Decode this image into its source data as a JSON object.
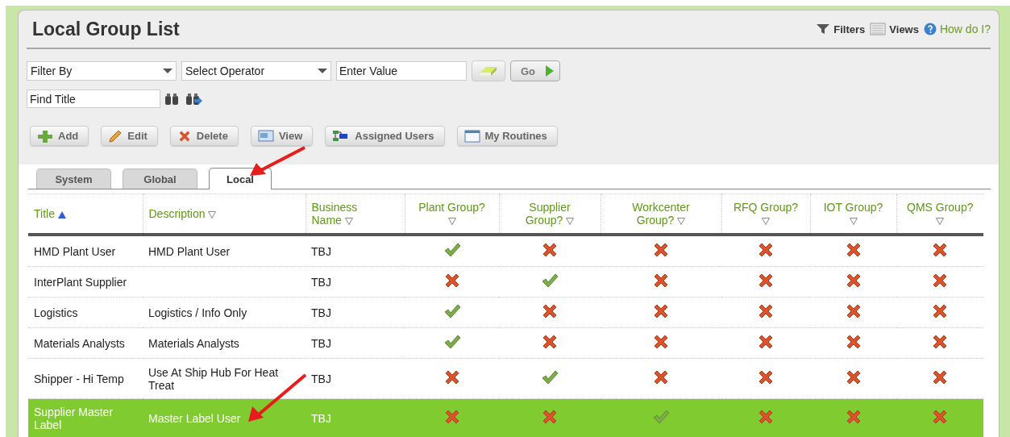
{
  "window": {
    "title": "Local Group List"
  },
  "header_links": [
    {
      "kind": "filters",
      "label": "Filters"
    },
    {
      "kind": "views",
      "label": "Views"
    },
    {
      "kind": "help",
      "label": "How do I?"
    }
  ],
  "filter": {
    "filter_by": "Filter By",
    "operator": "Select Operator",
    "value_placeholder": "Enter Value",
    "go_label": "Go",
    "find_placeholder": "Find Title"
  },
  "buttons": [
    {
      "kind": "add",
      "label": "Add"
    },
    {
      "kind": "edit",
      "label": "Edit"
    },
    {
      "kind": "delete",
      "label": "Delete"
    },
    {
      "kind": "view",
      "label": "View"
    },
    {
      "kind": "users",
      "label": "Assigned Users"
    },
    {
      "kind": "routines",
      "label": "My Routines"
    }
  ],
  "tabs": [
    {
      "label": "System",
      "selected": false
    },
    {
      "label": "Global",
      "selected": false
    },
    {
      "label": "Local",
      "selected": true
    }
  ],
  "table": {
    "columns": [
      {
        "label": "Title",
        "sorted": true
      },
      {
        "label": "Description",
        "sorted": false
      },
      {
        "label": "Business Name",
        "sorted": false
      },
      {
        "label": "Plant Group?",
        "sorted": false
      },
      {
        "label": "Supplier Group?",
        "sorted": false
      },
      {
        "label": "Workcenter Group?",
        "sorted": false
      },
      {
        "label": "RFQ Group?",
        "sorted": false
      },
      {
        "label": "IOT Group?",
        "sorted": false
      },
      {
        "label": "QMS Group?",
        "sorted": false
      }
    ],
    "rows": [
      {
        "title": "HMD Plant User",
        "description": "HMD Plant User",
        "business": "TBJ",
        "groups": [
          true,
          false,
          false,
          false,
          false,
          false
        ],
        "selected": false
      },
      {
        "title": "InterPlant Supplier",
        "business": "TBJ",
        "groups": [
          false,
          true,
          false,
          false,
          false,
          false
        ],
        "selected": false
      },
      {
        "title": "Logistics",
        "description": "Logistics / Info Only",
        "business": "TBJ",
        "groups": [
          true,
          false,
          false,
          false,
          false,
          false
        ],
        "selected": false
      },
      {
        "title": "Materials Analysts",
        "description": "Materials Analysts",
        "business": "TBJ",
        "groups": [
          true,
          false,
          false,
          false,
          false,
          false
        ],
        "selected": false
      },
      {
        "title": "Shipper - Hi Temp",
        "description": "Use At Ship Hub For Heat Treat",
        "business": "TBJ",
        "groups": [
          false,
          true,
          false,
          false,
          false,
          false
        ],
        "selected": false
      },
      {
        "title": "Supplier Master Label",
        "description": "Master Label User",
        "business": "TBJ",
        "groups": [
          false,
          false,
          true,
          false,
          false,
          false
        ],
        "selected": true
      }
    ]
  }
}
